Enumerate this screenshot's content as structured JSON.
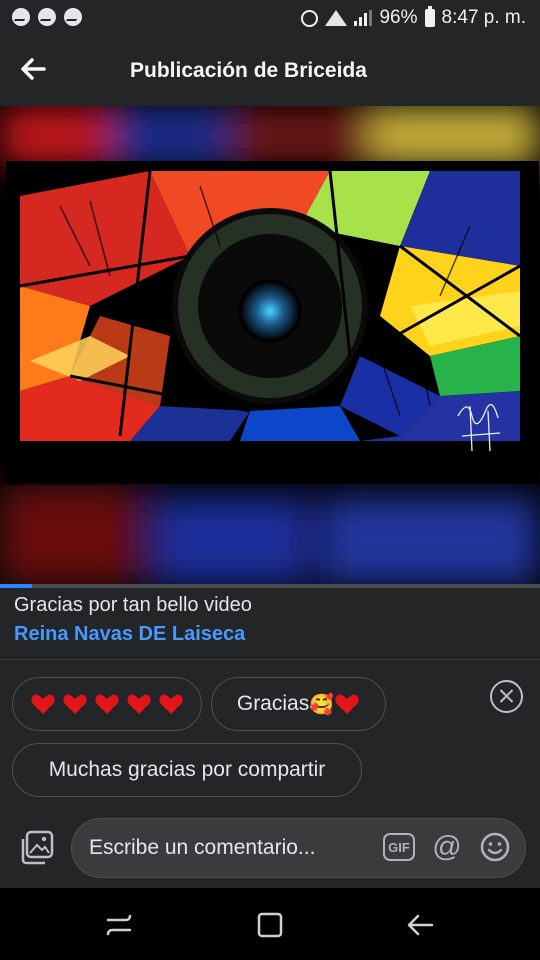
{
  "status_bar": {
    "left_icons": [
      "messenger-icon",
      "chat-bubble-icon",
      "messenger-icon"
    ],
    "battery": "96%",
    "time": "8:47 p. m."
  },
  "header": {
    "title": "Publicación de Briceida"
  },
  "media": {
    "progress": 0.06
  },
  "comment": {
    "text": "Gracias por tan bello video",
    "author": "Reina Navas DE Laiseca"
  },
  "quick_replies": {
    "hearts_count": 5,
    "gracias_label": "Gracias",
    "gracias_emoji": "🥰",
    "muchas_gracias_label": "Muchas gracias por compartir"
  },
  "composer": {
    "placeholder": "Escribe un comentario...",
    "gif_label": "GIF",
    "at_label": "@"
  },
  "colors": {
    "accent": "#2d88ff",
    "link": "#4599ff",
    "heart": "#e3161b",
    "background": "#242526"
  }
}
